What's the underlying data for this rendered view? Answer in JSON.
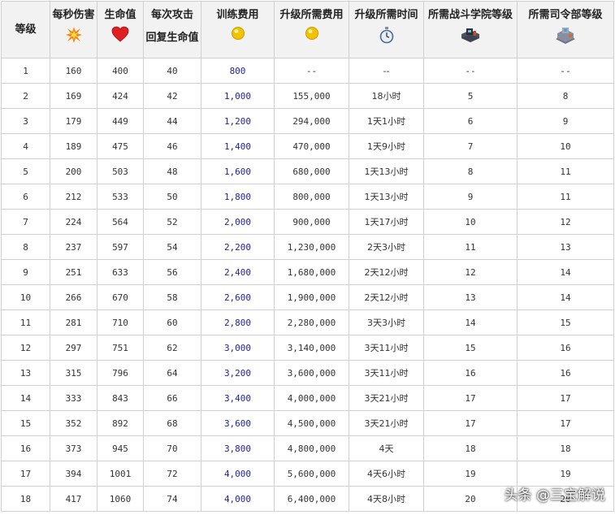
{
  "headers": {
    "level": "等级",
    "dps": "每秒伤害",
    "hp": "生命值",
    "heal_line1": "每次攻击",
    "heal_line2": "回复生命值",
    "train_cost": "训练费用",
    "upgrade_cost": "升级所需费用",
    "upgrade_time": "升级所需时间",
    "lab_level": "所需战斗学院等级",
    "hq_level": "所需司令部等级"
  },
  "icons": {
    "dps": "explosion-icon",
    "hp": "heart-icon",
    "train_cost": "gold-coin-icon",
    "upgrade_cost": "gold-coin-icon",
    "upgrade_time": "stopwatch-icon",
    "lab_level": "laboratory-icon",
    "hq_level": "headquarters-icon"
  },
  "colors": {
    "heart": "#e02020",
    "coin": "#f2c200",
    "cost_text": "#22229a"
  },
  "rows": [
    {
      "level": "1",
      "dps": "160",
      "hp": "400",
      "heal": "40",
      "train": "800",
      "upgrade": "--",
      "time": "--",
      "lab": "--",
      "hq": "--"
    },
    {
      "level": "2",
      "dps": "169",
      "hp": "424",
      "heal": "42",
      "train": "1,000",
      "upgrade": "155,000",
      "time": "18小时",
      "lab": "5",
      "hq": "8"
    },
    {
      "level": "3",
      "dps": "179",
      "hp": "449",
      "heal": "44",
      "train": "1,200",
      "upgrade": "294,000",
      "time": "1天1小时",
      "lab": "6",
      "hq": "9"
    },
    {
      "level": "4",
      "dps": "189",
      "hp": "475",
      "heal": "46",
      "train": "1,400",
      "upgrade": "470,000",
      "time": "1天9小时",
      "lab": "7",
      "hq": "10"
    },
    {
      "level": "5",
      "dps": "200",
      "hp": "503",
      "heal": "48",
      "train": "1,600",
      "upgrade": "680,000",
      "time": "1天13小时",
      "lab": "8",
      "hq": "11"
    },
    {
      "level": "6",
      "dps": "212",
      "hp": "533",
      "heal": "50",
      "train": "1,800",
      "upgrade": "800,000",
      "time": "1天13小时",
      "lab": "9",
      "hq": "11"
    },
    {
      "level": "7",
      "dps": "224",
      "hp": "564",
      "heal": "52",
      "train": "2,000",
      "upgrade": "900,000",
      "time": "1天17小时",
      "lab": "10",
      "hq": "12"
    },
    {
      "level": "8",
      "dps": "237",
      "hp": "597",
      "heal": "54",
      "train": "2,200",
      "upgrade": "1,230,000",
      "time": "2天3小时",
      "lab": "11",
      "hq": "13"
    },
    {
      "level": "9",
      "dps": "251",
      "hp": "633",
      "heal": "56",
      "train": "2,400",
      "upgrade": "1,680,000",
      "time": "2天12小时",
      "lab": "12",
      "hq": "14"
    },
    {
      "level": "10",
      "dps": "266",
      "hp": "670",
      "heal": "58",
      "train": "2,600",
      "upgrade": "1,900,000",
      "time": "2天12小时",
      "lab": "13",
      "hq": "14"
    },
    {
      "level": "11",
      "dps": "281",
      "hp": "710",
      "heal": "60",
      "train": "2,800",
      "upgrade": "2,280,000",
      "time": "3天3小时",
      "lab": "14",
      "hq": "15"
    },
    {
      "level": "12",
      "dps": "297",
      "hp": "751",
      "heal": "62",
      "train": "3,000",
      "upgrade": "3,140,000",
      "time": "3天11小时",
      "lab": "15",
      "hq": "16"
    },
    {
      "level": "13",
      "dps": "315",
      "hp": "796",
      "heal": "64",
      "train": "3,200",
      "upgrade": "3,600,000",
      "time": "3天11小时",
      "lab": "16",
      "hq": "16"
    },
    {
      "level": "14",
      "dps": "333",
      "hp": "843",
      "heal": "66",
      "train": "3,400",
      "upgrade": "4,000,000",
      "time": "3天21小时",
      "lab": "17",
      "hq": "17"
    },
    {
      "level": "15",
      "dps": "352",
      "hp": "892",
      "heal": "68",
      "train": "3,600",
      "upgrade": "4,500,000",
      "time": "3天21小时",
      "lab": "17",
      "hq": "17"
    },
    {
      "level": "16",
      "dps": "373",
      "hp": "945",
      "heal": "70",
      "train": "3,800",
      "upgrade": "4,800,000",
      "time": "4天",
      "lab": "18",
      "hq": "18"
    },
    {
      "level": "17",
      "dps": "394",
      "hp": "1001",
      "heal": "72",
      "train": "4,000",
      "upgrade": "5,600,000",
      "time": "4天6小时",
      "lab": "19",
      "hq": "19"
    },
    {
      "level": "18",
      "dps": "417",
      "hp": "1060",
      "heal": "74",
      "train": "4,000",
      "upgrade": "6,400,000",
      "time": "4天8小时",
      "lab": "20",
      "hq": "20"
    }
  ],
  "watermark": "头条 @三宝解说"
}
